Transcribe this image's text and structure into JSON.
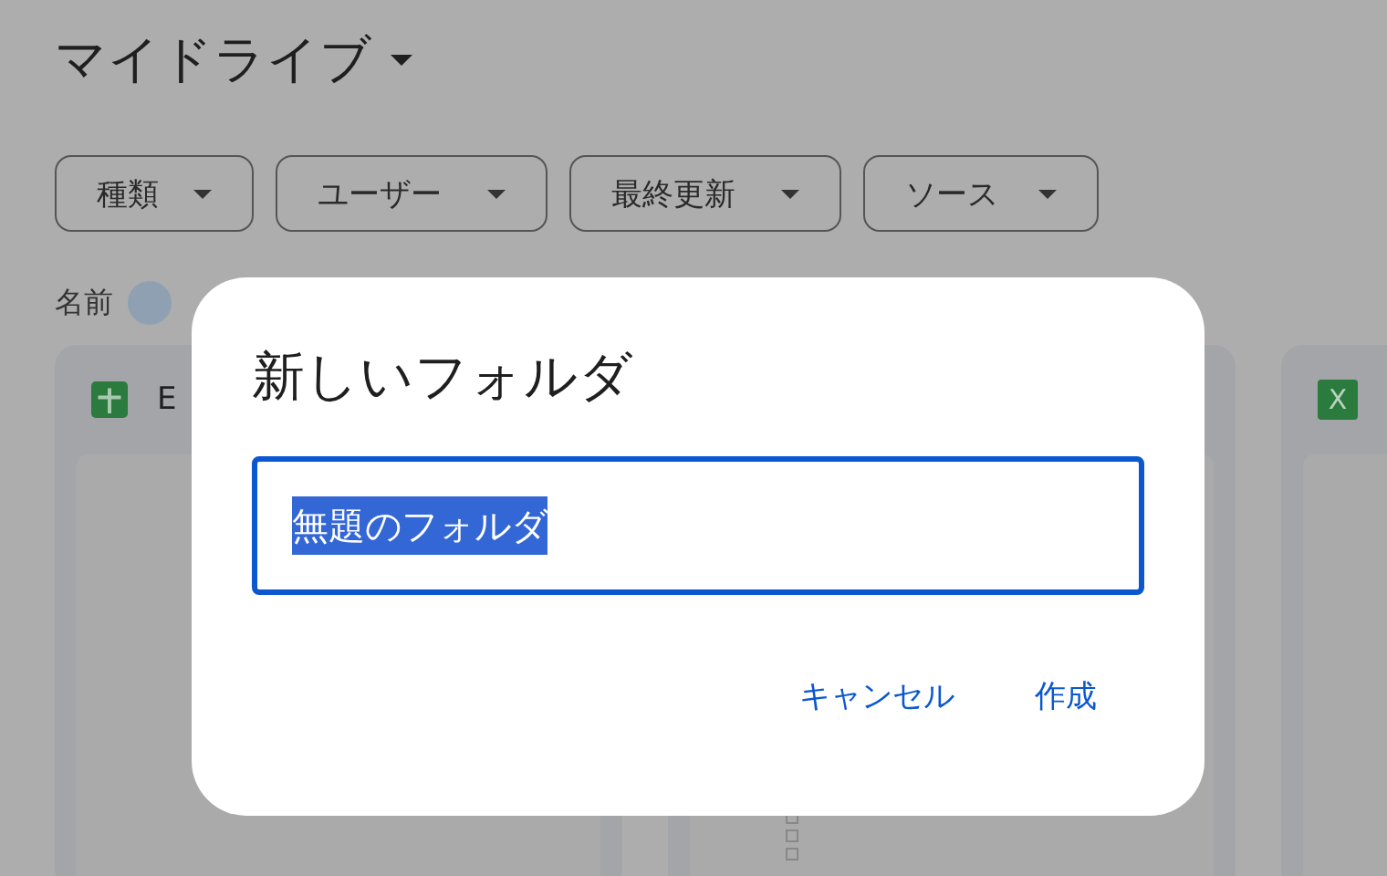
{
  "header": {
    "title": "マイドライブ"
  },
  "filters": [
    {
      "label": "種類"
    },
    {
      "label": "ユーザー"
    },
    {
      "label": "最終更新"
    },
    {
      "label": "ソース"
    }
  ],
  "sort": {
    "label": "名前"
  },
  "cards": [
    {
      "kind": "sheets",
      "title": "E"
    },
    {
      "kind": "doc"
    },
    {
      "kind": "excel",
      "badge": "X"
    }
  ],
  "dialog": {
    "title": "新しいフォルダ",
    "input": {
      "value": "無題のフォルダ",
      "text_selected": true
    },
    "buttons": [
      {
        "label": "キャンセル"
      },
      {
        "label": "作成"
      }
    ]
  }
}
